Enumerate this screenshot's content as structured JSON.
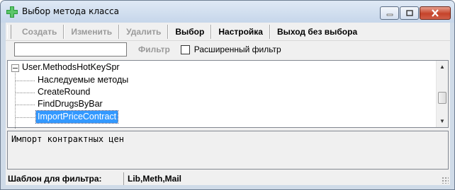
{
  "window": {
    "title": "Выбор метода класса"
  },
  "toolbar": {
    "buttons": [
      {
        "label": "Создать",
        "enabled": false
      },
      {
        "label": "Изменить",
        "enabled": false
      },
      {
        "label": "Удалить",
        "enabled": false
      },
      {
        "label": "Выбор",
        "enabled": true
      },
      {
        "label": "Настройка",
        "enabled": true
      },
      {
        "label": "Выход без выбора",
        "enabled": true
      }
    ]
  },
  "filter": {
    "input_value": "",
    "button_label": "Фильтр",
    "extended_checked": false,
    "extended_label": "Расширенный фильтр"
  },
  "tree": {
    "root": "User.MethodsHotKeySpr",
    "children": [
      "Наследуемые методы",
      "CreateRound",
      "FindDrugsByBar",
      "ImportPriceContract"
    ],
    "selected_index": 3
  },
  "description": {
    "text": "Импорт контрактных цен"
  },
  "status": {
    "label": "Шаблон для фильтра:",
    "value": "Lib,Meth,Mail"
  },
  "colors": {
    "selection": "#3399ff",
    "close_button": "#c5432a",
    "frame": "#cfdbe8"
  }
}
